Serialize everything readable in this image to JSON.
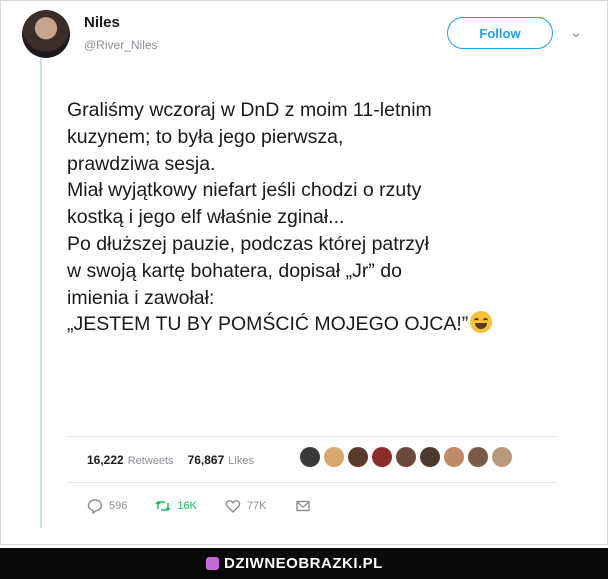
{
  "user": {
    "name": "Niles",
    "handle": "@River_Niles"
  },
  "follow_label": "Follow",
  "tweet_lines": [
    "Graliśmy wczoraj w DnD z moim 11-letnim",
    "kuzynem; to była jego pierwsza,",
    "prawdziwa sesja.",
    "Miał wyjątkowy niefart jeśli chodzi o rzuty",
    "kostką i jego elf właśnie zginał...",
    "Po dłuższej pauzie, podczas której patrzył",
    "w swoją kartę bohatera, dopisał „Jr” do",
    "imienia i zawołał:",
    "„JESTEM TU BY POMŚCIĆ MOJEGO OJCA!”"
  ],
  "stats": {
    "retweets_count": "16,222",
    "retweets_label": "Retweets",
    "likes_count": "76,867",
    "likes_label": "Likes"
  },
  "liker_colors": [
    "#3a3a3a",
    "#d7a86e",
    "#5a3a2a",
    "#8b2c2c",
    "#6b4a3a",
    "#4a3a30",
    "#c08a6a",
    "#7a5a4a",
    "#b89a7a"
  ],
  "actions": {
    "replies": "596",
    "retweets": "16K",
    "likes": "77K"
  },
  "colors": {
    "accent": "#1da1f2",
    "retweet": "#17bf63",
    "watermark_bg": "#0a0a0a"
  },
  "watermark": "DZIWNEOBRAZKI.PL"
}
